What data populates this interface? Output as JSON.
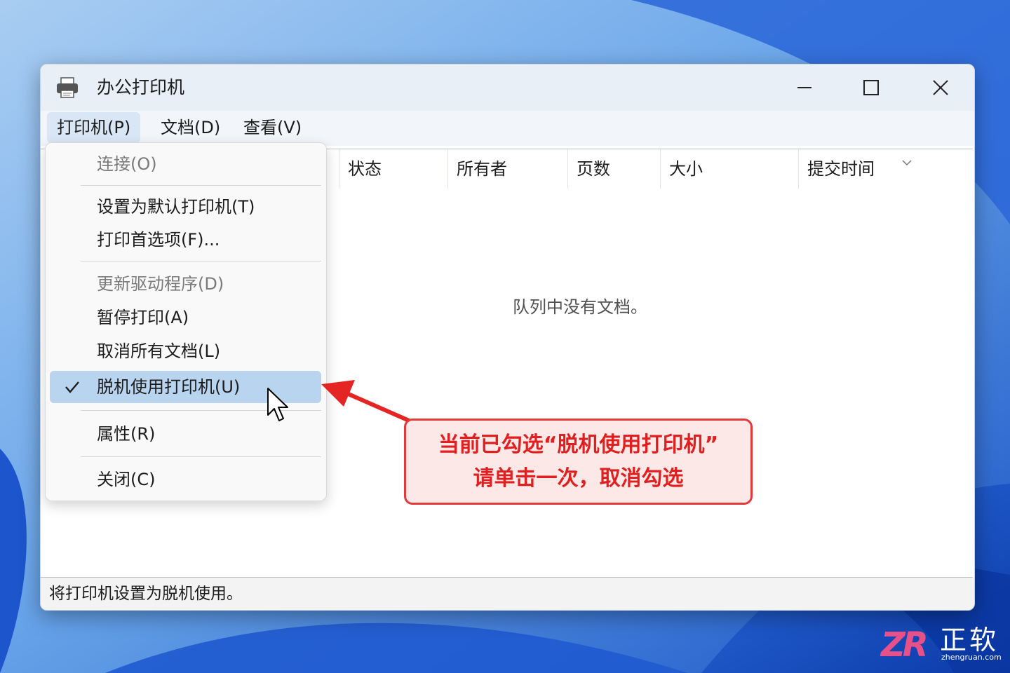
{
  "window": {
    "title": "办公打印机"
  },
  "menubar": {
    "items": [
      {
        "label": "打印机(P)"
      },
      {
        "label": "文档(D)"
      },
      {
        "label": "查看(V)"
      }
    ]
  },
  "columns": [
    "状态",
    "所有者",
    "页数",
    "大小",
    "提交时间"
  ],
  "empty_message": "队列中没有文档。",
  "status_text": "将打印机设置为脱机使用。",
  "printer_menu": {
    "items": [
      {
        "label": "连接(O)",
        "disabled": true
      },
      {
        "label": "设置为默认打印机(T)"
      },
      {
        "label": "打印首选项(F)..."
      },
      {
        "label": "更新驱动程序(D)",
        "disabled": true
      },
      {
        "label": "暂停打印(A)"
      },
      {
        "label": "取消所有文档(L)"
      },
      {
        "label": "脱机使用打印机(U)",
        "checked": true
      },
      {
        "label": "属性(R)"
      },
      {
        "label": "关闭(C)"
      }
    ]
  },
  "callout": {
    "line1": "当前已勾选“脱机使用打印机”",
    "line2": "请单击一次，取消勾选"
  },
  "watermark": {
    "logo": "ZR",
    "brand": "正软",
    "url": "zhengruan.com"
  },
  "colors": {
    "accent_red": "#e03a3a",
    "selection": "#b9d4ef",
    "desktop_blue": "#3d7fd9"
  }
}
